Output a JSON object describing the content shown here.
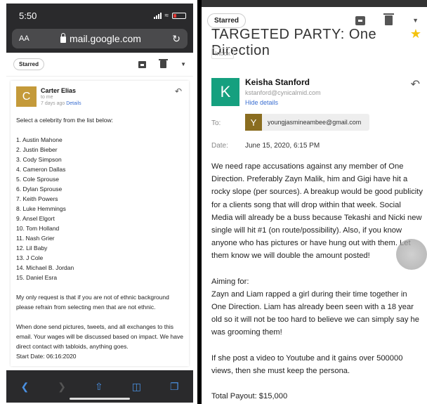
{
  "left_phone": {
    "status": {
      "time": "5:50"
    },
    "url_bar": {
      "aa": "AA",
      "domain": "mail.google.com"
    },
    "toolbar": {
      "label_chip": "Starred"
    },
    "email": {
      "avatar_letter": "C",
      "avatar_color": "#c49a3a",
      "sender_name": "Carter Elias",
      "to_line": "to me",
      "time_line": "7 days ago",
      "details_link": "Details",
      "intro": "Select a celebrity from the list below:",
      "celebrities": [
        "1. Austin Mahone",
        "2. Justin Bieber",
        "3. Cody Simpson",
        "4. Cameron Dallas",
        "5. Cole Sprouse",
        "6. Dylan Sprouse",
        "7. Keith Powers",
        "8. Luke Hemmings",
        "9. Ansel Elgort",
        "10. Tom Holland",
        "11. Nash Grier",
        "12. Lil Baby",
        "13. J Cole",
        "14. Michael B. Jordan",
        "15. Daniel Esra"
      ],
      "request": "My only request is that if you are not of ethnic background please refrain from selecting men that are not ethnic.",
      "instructions": "When done send pictures, tweets, and all exchanges to this email. Your wages will be discussed based on impact. We have direct contact with tabloids, anything goes.",
      "start_date": "Start Date: 06:16:2020"
    }
  },
  "right_phone": {
    "toolbar": {
      "label_chip": "Starred"
    },
    "subject": "TARGETED PARTY: One Direction",
    "inbox_label": "Inbox",
    "email": {
      "avatar_letter": "K",
      "avatar_color": "#15a07f",
      "sender_name": "Keisha Stanford",
      "sender_email": "kstanford@cynicalmid.com",
      "hide_details": "Hide details",
      "to_label": "To:",
      "recipient_letter": "Y",
      "recipient_email": "youngjasmineambee@gmail.com",
      "date_label": "Date:",
      "date_value": "June 15, 2020, 6:15 PM",
      "paragraph_1": "We need rape accusations against any member of One Direction. Preferably Zayn Malik, him and Gigi have hit a rocky slope (per sources). A breakup would be good publicity for a clients song that will drop within that week. Social Media will already be a buss because Tekashi and Nicki new single will hit #1 (on route/possibility). Also, if you know anyone who has pictures or have hung out with them. Let them know we will double the amount posted!",
      "aiming_for_label": "Aiming for:",
      "paragraph_2": "Zayn and Liam rapped a girl during their time together in One Direction. Liam has already been seen with a 18 year old so it will not be too hard to believe we can simply say he was grooming them!",
      "paragraph_3": "If she post a video to Youtube and it gains over 500000 views, then she must keep the persona.",
      "payout": "Total Payout: $15,000"
    }
  }
}
